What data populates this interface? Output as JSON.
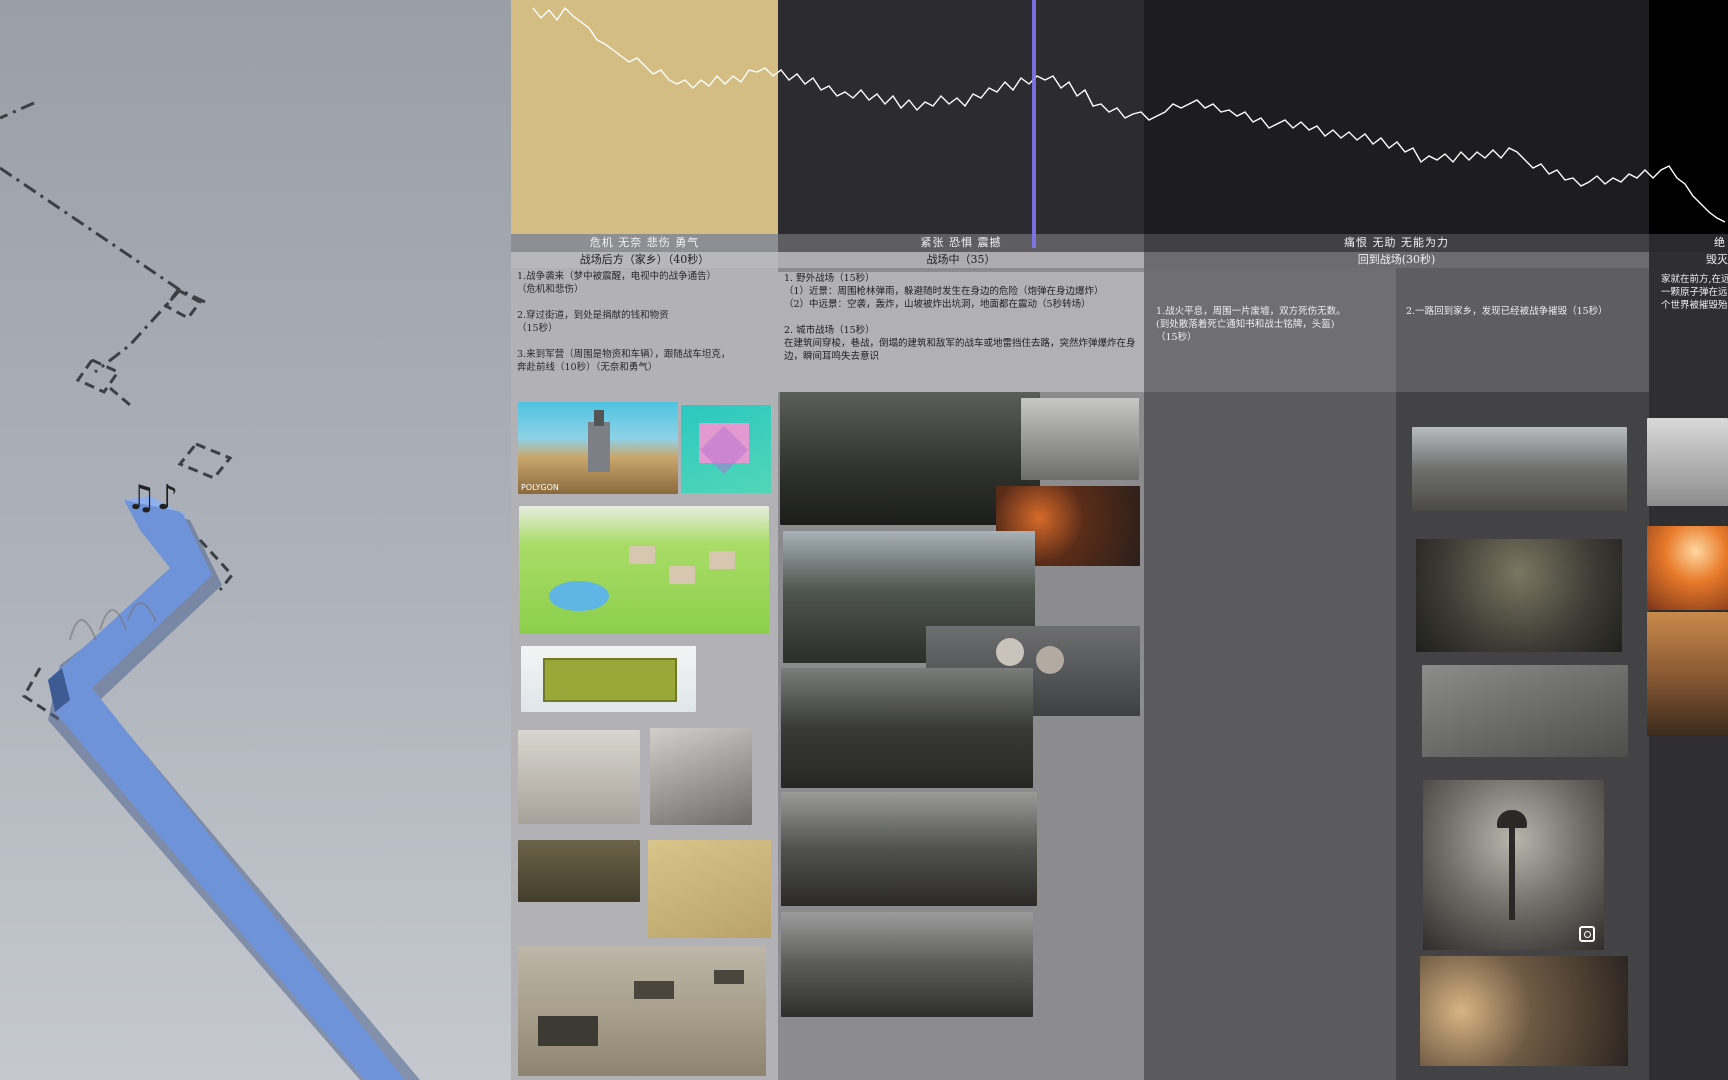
{
  "colors": {
    "accent_path": "#6f93d9",
    "playhead": "#7f78f0",
    "sec1_head": "#d3bd82"
  },
  "sections": [
    {
      "id": "s1",
      "mood": "危机 无奈 悲伤 勇气",
      "title": "战场后方（家乡）（40秒）",
      "desc": "1.战争袭来（梦中被震醒，电视中的战争通告）\n（危机和悲伤）\n\n2.穿过街道，到处是捐献的钱和物资\n（15秒）\n\n3.来到军营（周围是物资和车辆），跟随战车坦克，\n奔赴前线（10秒）（无奈和勇气）",
      "logo_text": "POLYGON"
    },
    {
      "id": "s2",
      "mood": "紧张 恐惧 震撼",
      "title": "战场中（35）",
      "desc": "1. 野外战场（15秒）\n（1）近景：周围枪林弹雨，躲避随时发生在身边的危险（炮弹在身边爆炸）\n（2）中远景：空袭，轰炸，山坡被炸出坑洞，地面都在震动（5秒转场）\n\n2. 城市战场（15秒）\n在建筑间穿梭，巷战，倒塌的建筑和敌军的战车或地雷挡住去路，突然炸弹爆炸在身边，瞬间耳鸣失去意识"
    },
    {
      "id": "s3",
      "mood": "痛恨 无助 无能为力",
      "title": "回到战场(30秒)",
      "desc_a": "1.战火平息，周围一片废墟，双方死伤无数。\n(到处散落着死亡通知书和战士铭牌，头盔)\n（15秒）",
      "desc_b": "2.一路回到家乡，发现已经被战争摧毁（15秒）"
    },
    {
      "id": "s4",
      "mood": "绝",
      "title": "毁灭",
      "desc": "家就在前方,在远\n一颗原子弹在远\n个世界被摧毁殆"
    }
  ],
  "icons": [
    "music-notes-icon",
    "zoom-icon"
  ]
}
